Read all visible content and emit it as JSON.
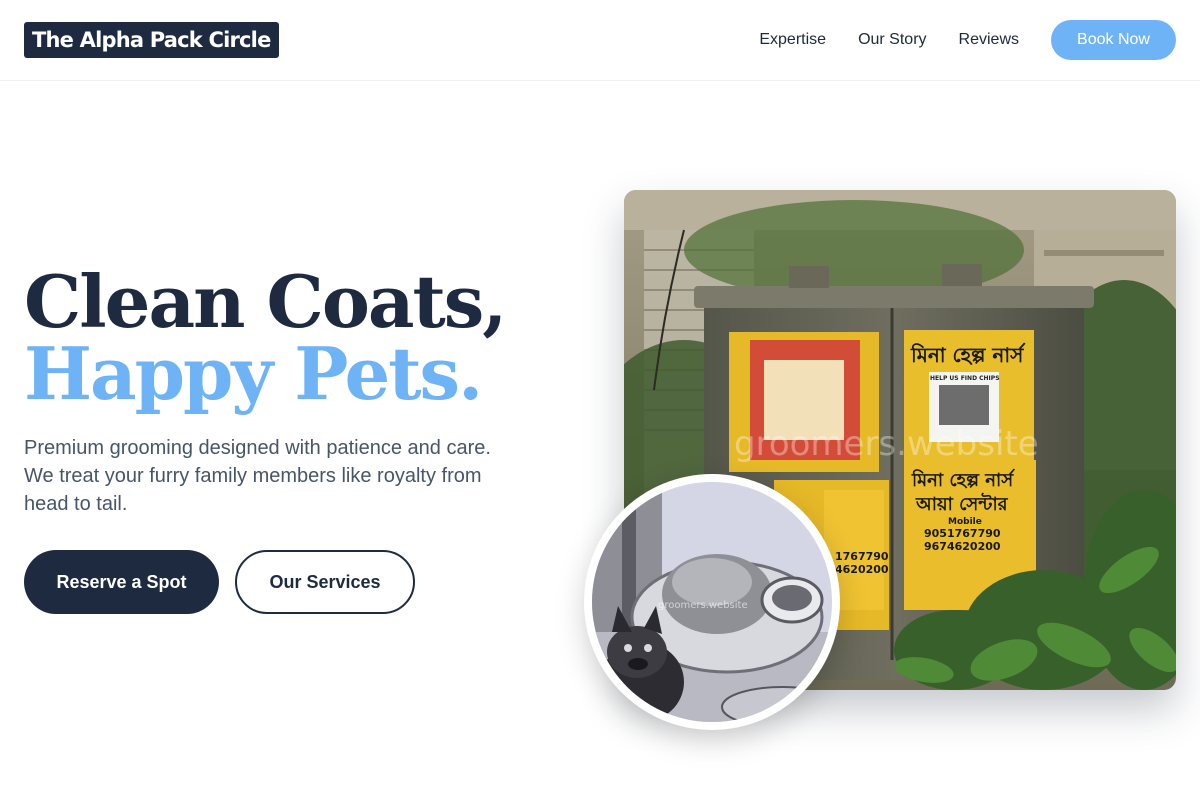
{
  "nav": {
    "logo": "The Alpha Pack Circle",
    "links": [
      "Expertise",
      "Our Story",
      "Reviews"
    ],
    "cta": "Book Now"
  },
  "hero": {
    "title_line1": "Clean Coats,",
    "title_line2": "Happy Pets.",
    "description": "Premium grooming designed with patience and care. We treat your furry family members like royalty from head to tail.",
    "primary_button": "Reserve a Spot",
    "secondary_button": "Our Services"
  },
  "images": {
    "main_photo": {
      "subject": "weathered cabinet with yellow posters surrounded by plants",
      "watermark": "groomers.website",
      "poster_texts": [
        "মিনা হেল্প নার্স",
        "HELP US FIND CHIPS",
        "মিনা হেল্প নার্স আয়া সেন্টার",
        "Mobile",
        "9051767790",
        "9674620200"
      ]
    },
    "circle_photo": {
      "subject": "dog beside a plate of food",
      "watermark": "groomers.website"
    }
  },
  "colors": {
    "navy": "#1e2a40",
    "accent": "#6fb3f7",
    "body_text": "#475569"
  }
}
